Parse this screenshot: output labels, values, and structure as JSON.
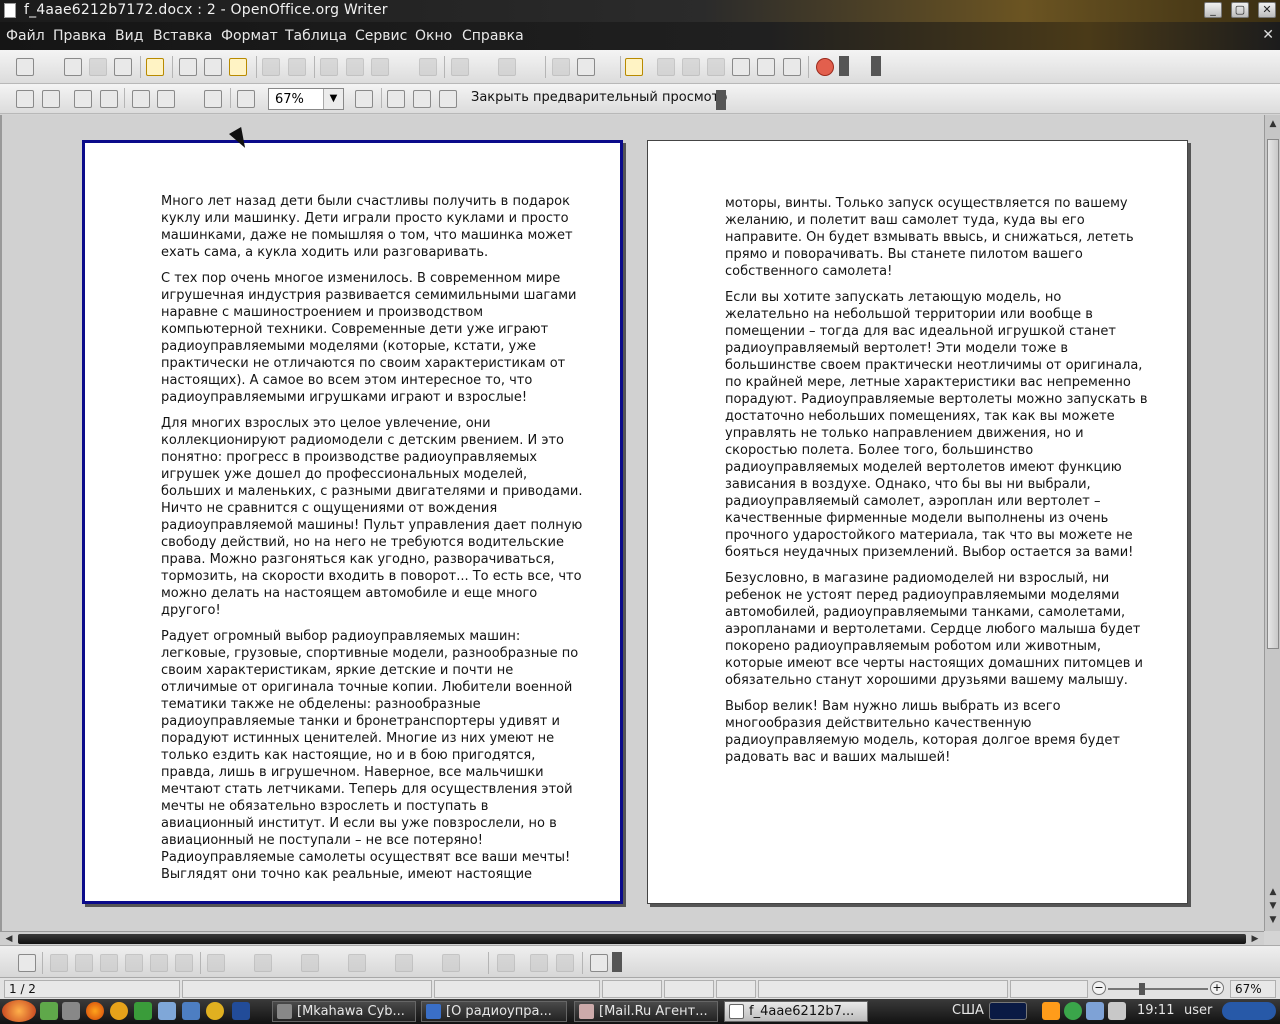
{
  "window": {
    "title": "f_4aae6212b7172.docx : 2 - OpenOffice.org Writer",
    "min_label": "_",
    "max_label": "▢",
    "close_label": "✕"
  },
  "menu": {
    "items": [
      "Файл",
      "Правка",
      "Вид",
      "Вставка",
      "Формат",
      "Таблица",
      "Сервис",
      "Окно",
      "Справка"
    ],
    "close_label": "✕"
  },
  "preview_toolbar": {
    "zoom_value": "67%",
    "close_preview_label": "Закрыть предварительный просмотр"
  },
  "pages": {
    "left": [
      "Много лет назад дети были счастливы получить в подарок куклу или машинку. Дети играли просто куклами и просто машинками, даже не помышляя о том, что машинка может ехать сама, а кукла ходить или разговаривать.",
      "С тех пор очень многое изменилось. В современном мире игрушечная индустрия развивается семимильными шагами наравне с машиностроением и производством компьютерной техники. Современные дети уже играют радиоуправляемыми моделями (которые, кстати, уже практически не отличаются по своим характеристикам от настоящих). А самое во всем этом интересное то, что радиоуправляемыми игрушками играют и взрослые!",
      "Для многих взрослых это целое увлечение, они коллекционируют радиомодели с детским рвением. И это понятно: прогресс в производстве радиоуправляемых игрушек уже дошел до профессиональных моделей, больших и маленьких, с разными двигателями и приводами. Ничто не сравнится с ощущениями от вождения радиоуправляемой машины! Пульт управления дает полную свободу действий, но на него не требуются водительские права. Можно разгоняться как угодно, разворачиваться, тормозить, на скорости входить в поворот... То есть все, что можно делать на настоящем автомобиле и еще много другого!",
      "Радует огромный выбор радиоуправляемых машин: легковые, грузовые, спортивные модели, разнообразные по своим характеристикам, яркие детские и почти не отличимые от оригинала точные копии. Любители военной тематики также не обделены: разнообразные радиоуправляемые танки и бронетранспортеры удивят и порадуют истинных ценителей. Многие из них умеют не только ездить как настоящие, но и в бою пригодятся, правда, лишь в игрушечном. Наверное, все мальчишки мечтают стать летчиками. Теперь для осуществления этой мечты не обязательно взрослеть и поступать в авиационный институт. И если вы уже повзрослели, но в авиационный не поступали – не все потеряно! Радиоуправляемые самолеты осуществят все ваши мечты! Выглядят они точно как реальные, имеют настоящие"
    ],
    "right": [
      "моторы, винты. Только запуск осуществляется по вашему желанию, и полетит ваш самолет туда, куда вы его направите. Он будет взмывать ввысь, и снижаться, лететь прямо и поворачивать. Вы станете пилотом вашего собственного самолета!",
      "Если вы хотите запускать летающую модель, но желательно на небольшой территории или вообще в помещении – тогда для вас идеальной игрушкой станет радиоуправляемый вертолет! Эти модели тоже в большинстве своем практически неотличимы от оригинала, по крайней мере, летные характеристики вас непременно порадуют. Радиоуправляемые вертолеты можно запускать в достаточно небольших помещениях, так как вы можете управлять не только направлением движения, но и скоростью полета. Более того, большинство радиоуправляемых моделей вертолетов имеют функцию зависания в воздухе. Однако, что бы вы ни выбрали, радиоуправляемый самолет, аэроплан или вертолет – качественные фирменные модели выполнены из очень прочного ударостойкого материала, так что вы можете не бояться неудачных приземлений. Выбор остается за вами!",
      "Безусловно, в магазине радиомоделей ни взрослый, ни ребенок не устоят перед радиоуправляемыми моделями автомобилей, радиоуправляемыми танками, самолетами, аэропланами и вертолетами. Сердце любого малыша будет покорено радиоуправляемым роботом или животным, которые имеют все черты настоящих домашних питомцев и обязательно станут хорошими друзьями вашему малышу.",
      "Выбор велик! Вам нужно лишь выбрать из всего многообразия действительно качественную радиоуправляемую модель, которая долгое время будет радовать вас и ваших малышей!"
    ]
  },
  "statusbar": {
    "page_indicator": "1 / 2",
    "zoom_percent": "67%",
    "zoom_level": 0.34
  },
  "taskbar": {
    "tasks": [
      {
        "label": "[Mkahawa Cyb...",
        "active": false
      },
      {
        "label": "[О радиоупра...",
        "active": false
      },
      {
        "label": "[Mail.Ru Агент...",
        "active": false
      },
      {
        "label": "f_4aae6212b7...",
        "active": true
      }
    ],
    "keyboard_layout": "США",
    "clock": "19:11",
    "user": "user"
  },
  "colors": {
    "selected_page_border": "#0b0b8a",
    "accent_gold": "#6b5422"
  }
}
